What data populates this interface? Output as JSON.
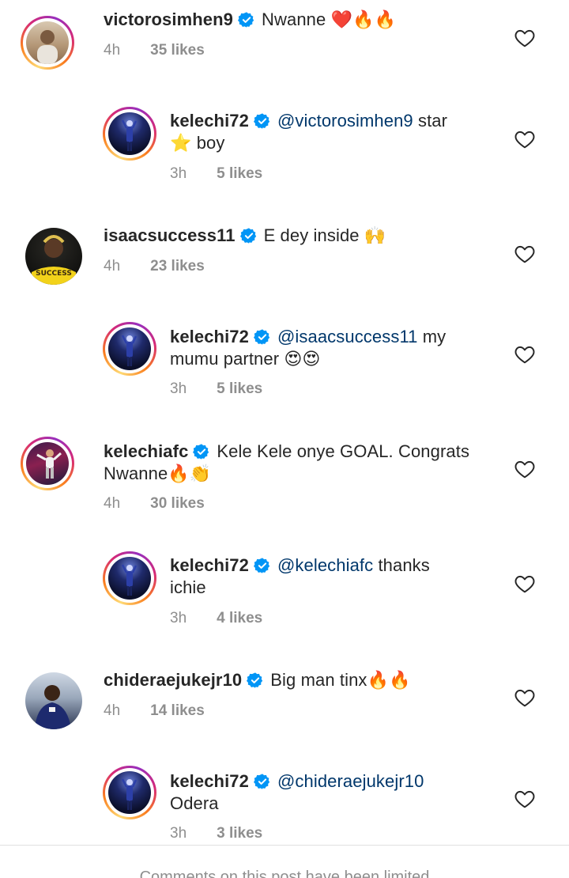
{
  "comments": [
    {
      "username": "victorosimhen9",
      "text_line1": "Nwanne ❤️🔥🔥",
      "mention": "",
      "text_line2": "",
      "time": "4h",
      "likes": "35 likes",
      "avatar_icon": "profile-photo-victorosimhen9"
    },
    {
      "username": "kelechi72",
      "mention": "@victorosimhen9",
      "text_line1": " star",
      "text_line2": "⭐ boy",
      "time": "3h",
      "likes": "5 likes",
      "avatar_icon": "profile-photo-kelechi72"
    },
    {
      "username": "isaacsuccess11",
      "text_line1": "E dey inside 🙌",
      "mention": "",
      "text_line2": "",
      "time": "4h",
      "likes": "23 likes",
      "avatar_icon": "profile-photo-isaacsuccess11",
      "avatar_text": "SUCCESS"
    },
    {
      "username": "kelechi72",
      "mention": "@isaacsuccess11",
      "text_line1": " my",
      "text_line2": "mumu partner 😍😍",
      "time": "3h",
      "likes": "5 likes",
      "avatar_icon": "profile-photo-kelechi72"
    },
    {
      "username": "kelechiafc",
      "text_line1": "Kele Kele onye GOAL. Congrats",
      "mention": "",
      "text_line2": "Nwanne🔥👏",
      "time": "4h",
      "likes": "30 likes",
      "avatar_icon": "profile-photo-kelechiafc"
    },
    {
      "username": "kelechi72",
      "mention": "@kelechiafc",
      "text_line1": " thanks",
      "text_line2": "ichie",
      "time": "3h",
      "likes": "4 likes",
      "avatar_icon": "profile-photo-kelechi72"
    },
    {
      "username": "chideraejukejr10",
      "text_line1": "Big man tinx🔥🔥",
      "mention": "",
      "text_line2": "",
      "time": "4h",
      "likes": "14 likes",
      "avatar_icon": "profile-photo-chideraejukejr10"
    },
    {
      "username": "kelechi72",
      "mention": "@chideraejukejr10",
      "text_line1": "",
      "text_line2": "Odera",
      "time": "3h",
      "likes": "3 likes",
      "avatar_icon": "profile-photo-kelechi72"
    }
  ],
  "footer_note": "Comments on this post have been limited",
  "colors": {
    "text": "#262626",
    "muted": "#8e8e8e",
    "mention": "#00376b",
    "verified_badge": "#0095f6"
  },
  "icons": {
    "verified": "verified-badge-icon",
    "like": "heart-outline-icon"
  }
}
